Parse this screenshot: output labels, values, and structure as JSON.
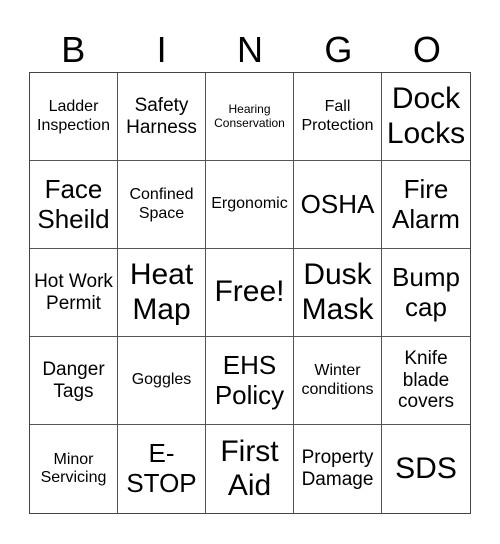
{
  "header": {
    "letters": [
      "B",
      "I",
      "N",
      "G",
      "O"
    ]
  },
  "grid": {
    "cells": [
      {
        "text": "Ladder Inspection",
        "size": "sm"
      },
      {
        "text": "Safety Harness",
        "size": "md"
      },
      {
        "text": "Hearing Conservation",
        "size": "xs"
      },
      {
        "text": "Fall Protection",
        "size": "sm"
      },
      {
        "text": "Dock Locks",
        "size": "xxl"
      },
      {
        "text": "Face Sheild",
        "size": "xl"
      },
      {
        "text": "Confined Space",
        "size": "sm"
      },
      {
        "text": "Ergonomic",
        "size": "sm"
      },
      {
        "text": "OSHA",
        "size": "xl"
      },
      {
        "text": "Fire Alarm",
        "size": "xl"
      },
      {
        "text": "Hot Work Permit",
        "size": "md"
      },
      {
        "text": "Heat Map",
        "size": "xxl"
      },
      {
        "text": "Free!",
        "size": "xxl"
      },
      {
        "text": "Dusk Mask",
        "size": "xxl"
      },
      {
        "text": "Bump cap",
        "size": "xl"
      },
      {
        "text": "Danger Tags",
        "size": "md"
      },
      {
        "text": "Goggles",
        "size": "sm"
      },
      {
        "text": "EHS Policy",
        "size": "xl"
      },
      {
        "text": "Winter conditions",
        "size": "sm"
      },
      {
        "text": "Knife blade covers",
        "size": "md"
      },
      {
        "text": "Minor Servicing",
        "size": "sm"
      },
      {
        "text": "E-STOP",
        "size": "xl"
      },
      {
        "text": "First Aid",
        "size": "xxl"
      },
      {
        "text": "Property Damage",
        "size": "md"
      },
      {
        "text": "SDS",
        "size": "xxl"
      }
    ]
  }
}
